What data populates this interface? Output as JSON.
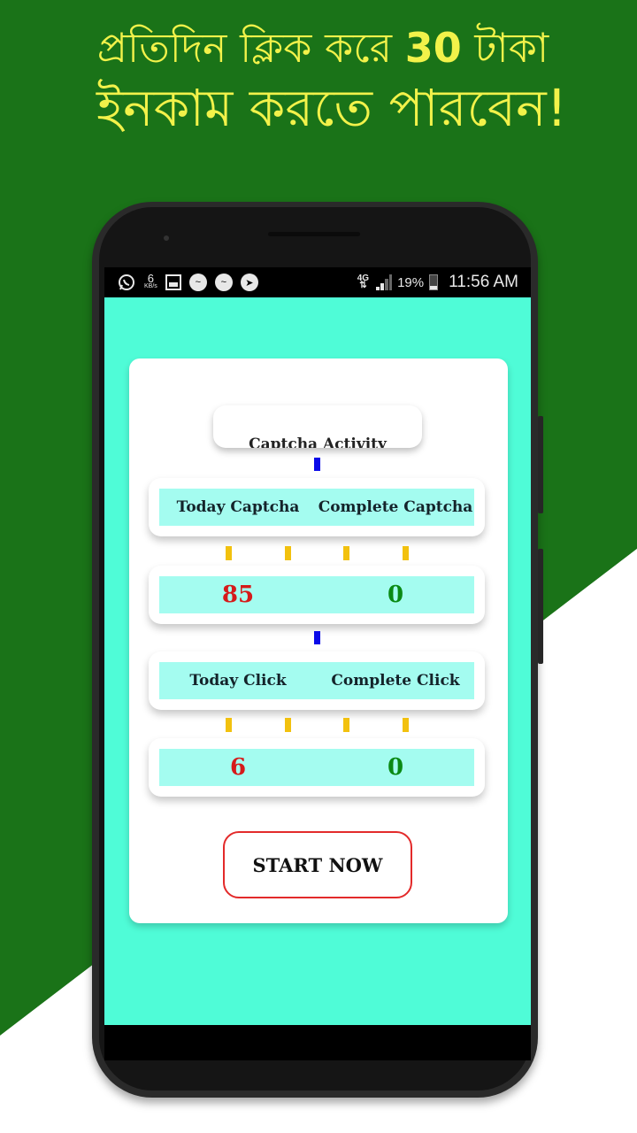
{
  "promo": {
    "line1_prefix": "প্রতিদিন ক্লিক করে ",
    "line1_amount": "30",
    "line1_suffix": " টাকা",
    "line2": "ইনকাম করতে পারবেন!",
    "text_color": "#f2f24a",
    "bg_color": "#1a7318"
  },
  "statusbar": {
    "notification_icons": [
      "whatsapp-icon",
      "data-speed",
      "gallery-icon",
      "messenger-icon",
      "messenger-icon",
      "telegram-icon"
    ],
    "data_speed_value": "6",
    "data_speed_unit": "KB/s",
    "network": "4G",
    "battery_percent": "19%",
    "time": "11:56 AM"
  },
  "app": {
    "screen_bg": "#4ffcd7",
    "title": "Captcha Activity",
    "captcha": {
      "today_label": "Today Captcha",
      "complete_label": "Complete Captcha",
      "today_value": "85",
      "complete_value": "0"
    },
    "click": {
      "today_label": "Today Click",
      "complete_label": "Complete Click",
      "today_value": "6",
      "complete_value": "0"
    },
    "start_button": "START NOW"
  }
}
